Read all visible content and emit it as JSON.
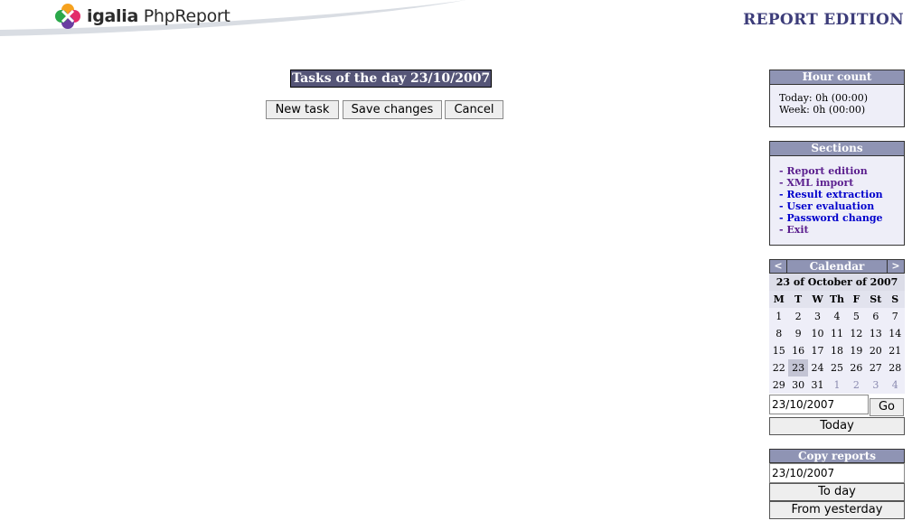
{
  "header": {
    "logo_brand": "igalia",
    "logo_product": "PhpReport",
    "page_heading": "REPORT EDITION"
  },
  "main": {
    "tasks_title": "Tasks of the day 23/10/2007",
    "buttons": {
      "new_task": "New task",
      "save": "Save changes",
      "cancel": "Cancel"
    }
  },
  "hour_count": {
    "title": "Hour count",
    "today": "Today: 0h (00:00)",
    "week": "Week: 0h (00:00)"
  },
  "sections": {
    "title": "Sections",
    "items": [
      {
        "label": "- Report edition",
        "visited": true
      },
      {
        "label": "- XML import",
        "visited": true
      },
      {
        "label": "- Result extraction",
        "visited": false
      },
      {
        "label": "- User evaluation",
        "visited": false
      },
      {
        "label": "- Password change",
        "visited": false
      },
      {
        "label": "- Exit",
        "visited": true
      }
    ]
  },
  "calendar": {
    "title": "Calendar",
    "prev": "<",
    "next": ">",
    "month_label": "23 of October of 2007",
    "weekdays": [
      "M",
      "T",
      "W",
      "Th",
      "F",
      "St",
      "S"
    ],
    "weeks": [
      [
        "1",
        "2",
        "3",
        "4",
        "5",
        "6",
        "7"
      ],
      [
        "8",
        "9",
        "10",
        "11",
        "12",
        "13",
        "14"
      ],
      [
        "15",
        "16",
        "17",
        "18",
        "19",
        "20",
        "21"
      ],
      [
        "22",
        "23",
        "24",
        "25",
        "26",
        "27",
        "28"
      ],
      [
        "29",
        "30",
        "31",
        "1",
        "2",
        "3",
        "4"
      ]
    ],
    "selected_day": "23",
    "date_value": "23/10/2007",
    "go": "Go",
    "today": "Today"
  },
  "copy_reports": {
    "title": "Copy reports",
    "date_value": "23/10/2007",
    "to_day": "To day",
    "from_yesterday": "From yesterday"
  },
  "colors": {
    "box_title_bg": "#8f94b4",
    "box_bg": "#eeeef8",
    "heading": "#3d3d7a",
    "visited_link": "#5b1f8e",
    "link": "#0000cc"
  }
}
